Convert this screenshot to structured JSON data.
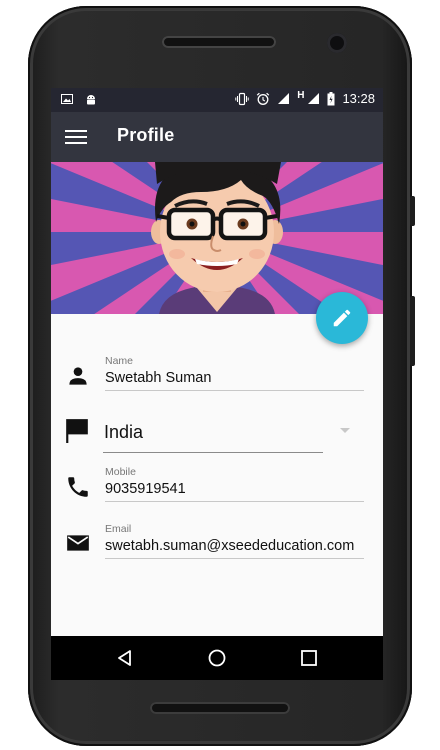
{
  "status_bar": {
    "time": "13:28",
    "network_label": "H",
    "icons": [
      "image-icon",
      "android-icon",
      "vibrate-icon",
      "alarm-icon",
      "signal-icon",
      "signal-icon",
      "battery-icon"
    ]
  },
  "toolbar": {
    "title": "Profile",
    "menu_icon": "hamburger-menu-icon"
  },
  "header": {
    "image": "cartoon-avatar-with-glasses-on-sunburst",
    "fab_icon": "pencil-edit-icon",
    "accent_color": "#2ab8d8"
  },
  "form": {
    "name": {
      "label": "Name",
      "value": "Swetabh Suman",
      "icon": "person-icon"
    },
    "country": {
      "value": "India",
      "icon": "flag-icon"
    },
    "mobile": {
      "label": "Mobile",
      "value": "9035919541",
      "icon": "phone-icon"
    },
    "email": {
      "label": "Email",
      "value": "swetabh.suman@xseededucation.com",
      "icon": "email-icon"
    }
  },
  "nav_bar": {
    "buttons": [
      "back-icon",
      "home-icon",
      "recents-icon"
    ]
  },
  "colors": {
    "toolbar": "#33353f",
    "status_bar": "#252631",
    "ray_pink": "#d858b0",
    "ray_blue": "#5556b4"
  }
}
